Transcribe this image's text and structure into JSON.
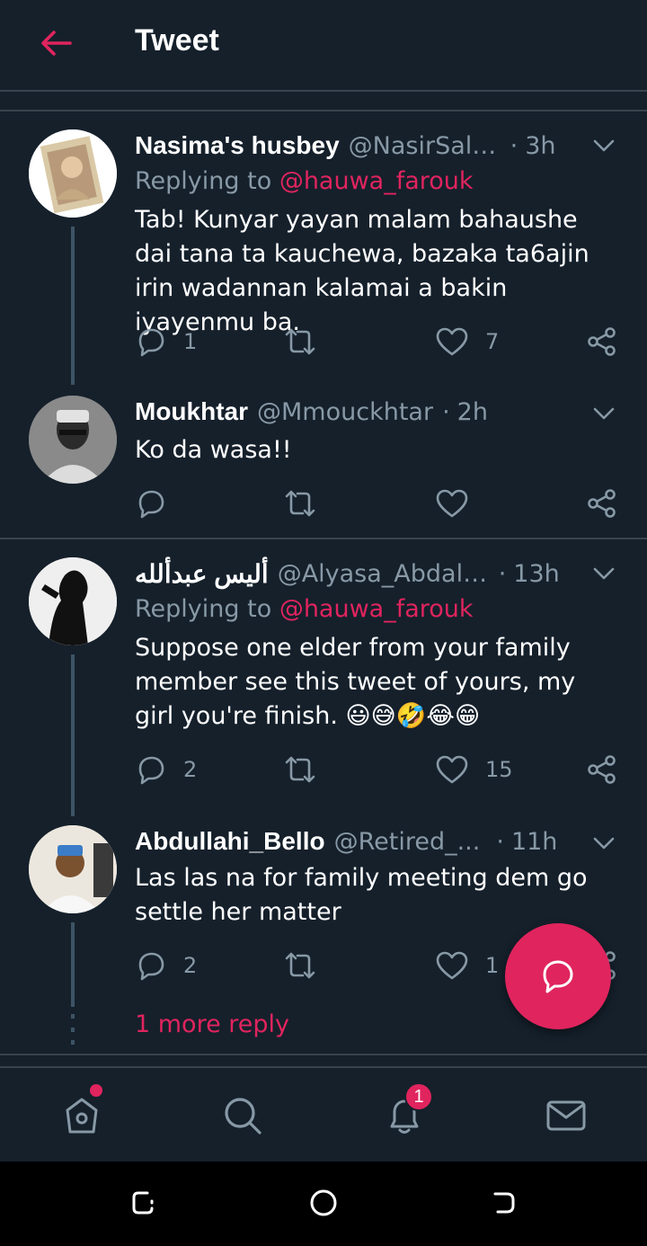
{
  "header": {
    "title": "Tweet",
    "back_icon": "arrow-left-icon",
    "accent": "#e0245e"
  },
  "tweets": [
    {
      "name": "Nasima's husbey",
      "handle": "@NasirSali...",
      "time": "3h",
      "replying_prefix": "Replying to",
      "replying_to": "@hauwa_farouk",
      "text": "Tab! Kunyar yayan malam bahaushe dai tana ta kauchewa, bazaka ta6ajin irin wadannan kalamai a bakin iyayenmu ba.",
      "replies": "1",
      "retweets": "",
      "likes": "7"
    },
    {
      "name": "Moukhtar",
      "handle": "@Mmouckhtar",
      "time": "2h",
      "text": "Ko da wasa!!",
      "replies": "",
      "retweets": "",
      "likes": ""
    },
    {
      "name": "أليس عبدألله",
      "handle": "@Alyasa_Abdall...",
      "time": "13h",
      "replying_prefix": "Replying to",
      "replying_to": "@hauwa_farouk",
      "text": "Suppose one elder from your family member see this tweet of yours, my girl you're finish. 😃😅🤣😂😁",
      "replies": "2",
      "retweets": "",
      "likes": "15"
    },
    {
      "name": "Abdullahi_Bello",
      "handle": "@Retired_...",
      "time": "11h",
      "text": "Las las na for family meeting dem go settle her matter",
      "replies": "2",
      "retweets": "",
      "likes": "1"
    }
  ],
  "more_reply": "1 more reply",
  "tabbar": {
    "notifications_badge": "1"
  },
  "icons": {
    "reply": "reply-icon",
    "retweet": "retweet-icon",
    "like": "heart-icon",
    "share": "share-icon",
    "caret": "chevron-down-icon",
    "fab": "compose-reply-icon",
    "home": "home-icon",
    "search": "search-icon",
    "notifications": "bell-icon",
    "messages": "mail-icon"
  },
  "colors": {
    "background": "#15202b",
    "secondary_text": "#8899a6",
    "divider": "#38444d",
    "accent": "#e0245e"
  }
}
